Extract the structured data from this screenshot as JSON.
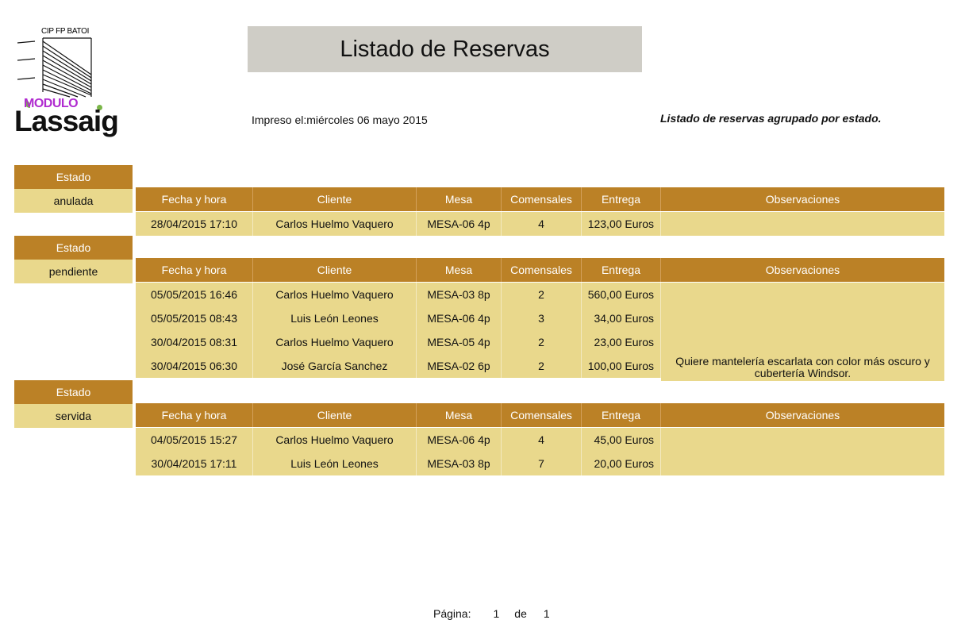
{
  "logo": {
    "top_text": "CIP FP BATOI",
    "modulo": "MODULO",
    "brand": "Lassaig"
  },
  "title": "Listado de Reservas",
  "printed": "Impreso el:miércoles 06 mayo 2015",
  "description": "Listado de reservas agrupado por estado.",
  "estado_label": "Estado",
  "columns": [
    "Fecha y hora",
    "Cliente",
    "Mesa",
    "Comensales",
    "Entrega",
    "Observaciones"
  ],
  "groups": [
    {
      "estado": "anulada",
      "rows": [
        [
          "28/04/2015 17:10",
          "Carlos Huelmo Vaquero",
          "MESA-06 4p",
          "4",
          "123,00 Euros",
          ""
        ]
      ]
    },
    {
      "estado": "pendiente",
      "rows": [
        [
          "05/05/2015 16:46",
          "Carlos Huelmo Vaquero",
          "MESA-03 8p",
          "2",
          "560,00 Euros",
          ""
        ],
        [
          "05/05/2015 08:43",
          "Luis León Leones",
          "MESA-06 4p",
          "3",
          "34,00 Euros",
          ""
        ],
        [
          "30/04/2015 08:31",
          "Carlos Huelmo Vaquero",
          "MESA-05 4p",
          "2",
          "23,00 Euros",
          ""
        ],
        [
          "30/04/2015 06:30",
          "José García Sanchez",
          "MESA-02 6p",
          "2",
          "100,00 Euros",
          "Quiere mantelería escarlata con color más oscuro y cubertería Windsor."
        ]
      ]
    },
    {
      "estado": "servida",
      "rows": [
        [
          "04/05/2015 15:27",
          "Carlos Huelmo Vaquero",
          "MESA-06 4p",
          "4",
          "45,00 Euros",
          ""
        ],
        [
          "30/04/2015 17:11",
          "Luis León Leones",
          "MESA-03 8p",
          "7",
          "20,00 Euros",
          ""
        ]
      ]
    }
  ],
  "footer": {
    "page_label": "Página:",
    "page": "1",
    "of_label": "de",
    "total": "1"
  },
  "colors": {
    "header": "#bb8126",
    "row": "#e9d88c",
    "title_bg": "#cfcdc6"
  }
}
